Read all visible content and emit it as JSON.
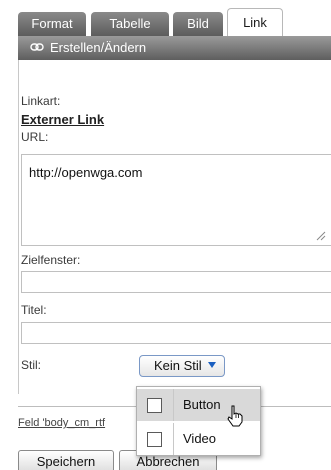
{
  "tabs": [
    {
      "label": "Format",
      "active": false
    },
    {
      "label": "Tabelle",
      "active": false
    },
    {
      "label": "Bild",
      "active": false
    },
    {
      "label": "Link",
      "active": true
    }
  ],
  "panel": {
    "title": "Erstellen/Ändern",
    "title_icon": "link-icon",
    "linkart_label": "Linkart:",
    "linkart_value": "Externer Link",
    "url_label": "URL:",
    "url_value": "http://openwga.com",
    "zielfenster_label": "Zielfenster:",
    "zielfenster_value": "",
    "titel_label": "Titel:",
    "titel_value": "",
    "stil_label": "Stil:",
    "stil_value": "Kein Stil"
  },
  "style_dropdown": {
    "open": true,
    "options": [
      {
        "label": "Button",
        "checked": false,
        "hovered": true
      },
      {
        "label": "Video",
        "checked": false,
        "hovered": false
      }
    ]
  },
  "footer": {
    "field_link": "Feld 'body_cm_rtf",
    "field_link_suffix": "...",
    "save_label": "Speichern",
    "cancel_label": "Abbrechen"
  },
  "colors": {
    "tab_bg": "#6e6e6e",
    "header_bg": "#7a7a7a",
    "select_caret": "#1a5fc0",
    "hover_bg": "#d9d9d9"
  }
}
